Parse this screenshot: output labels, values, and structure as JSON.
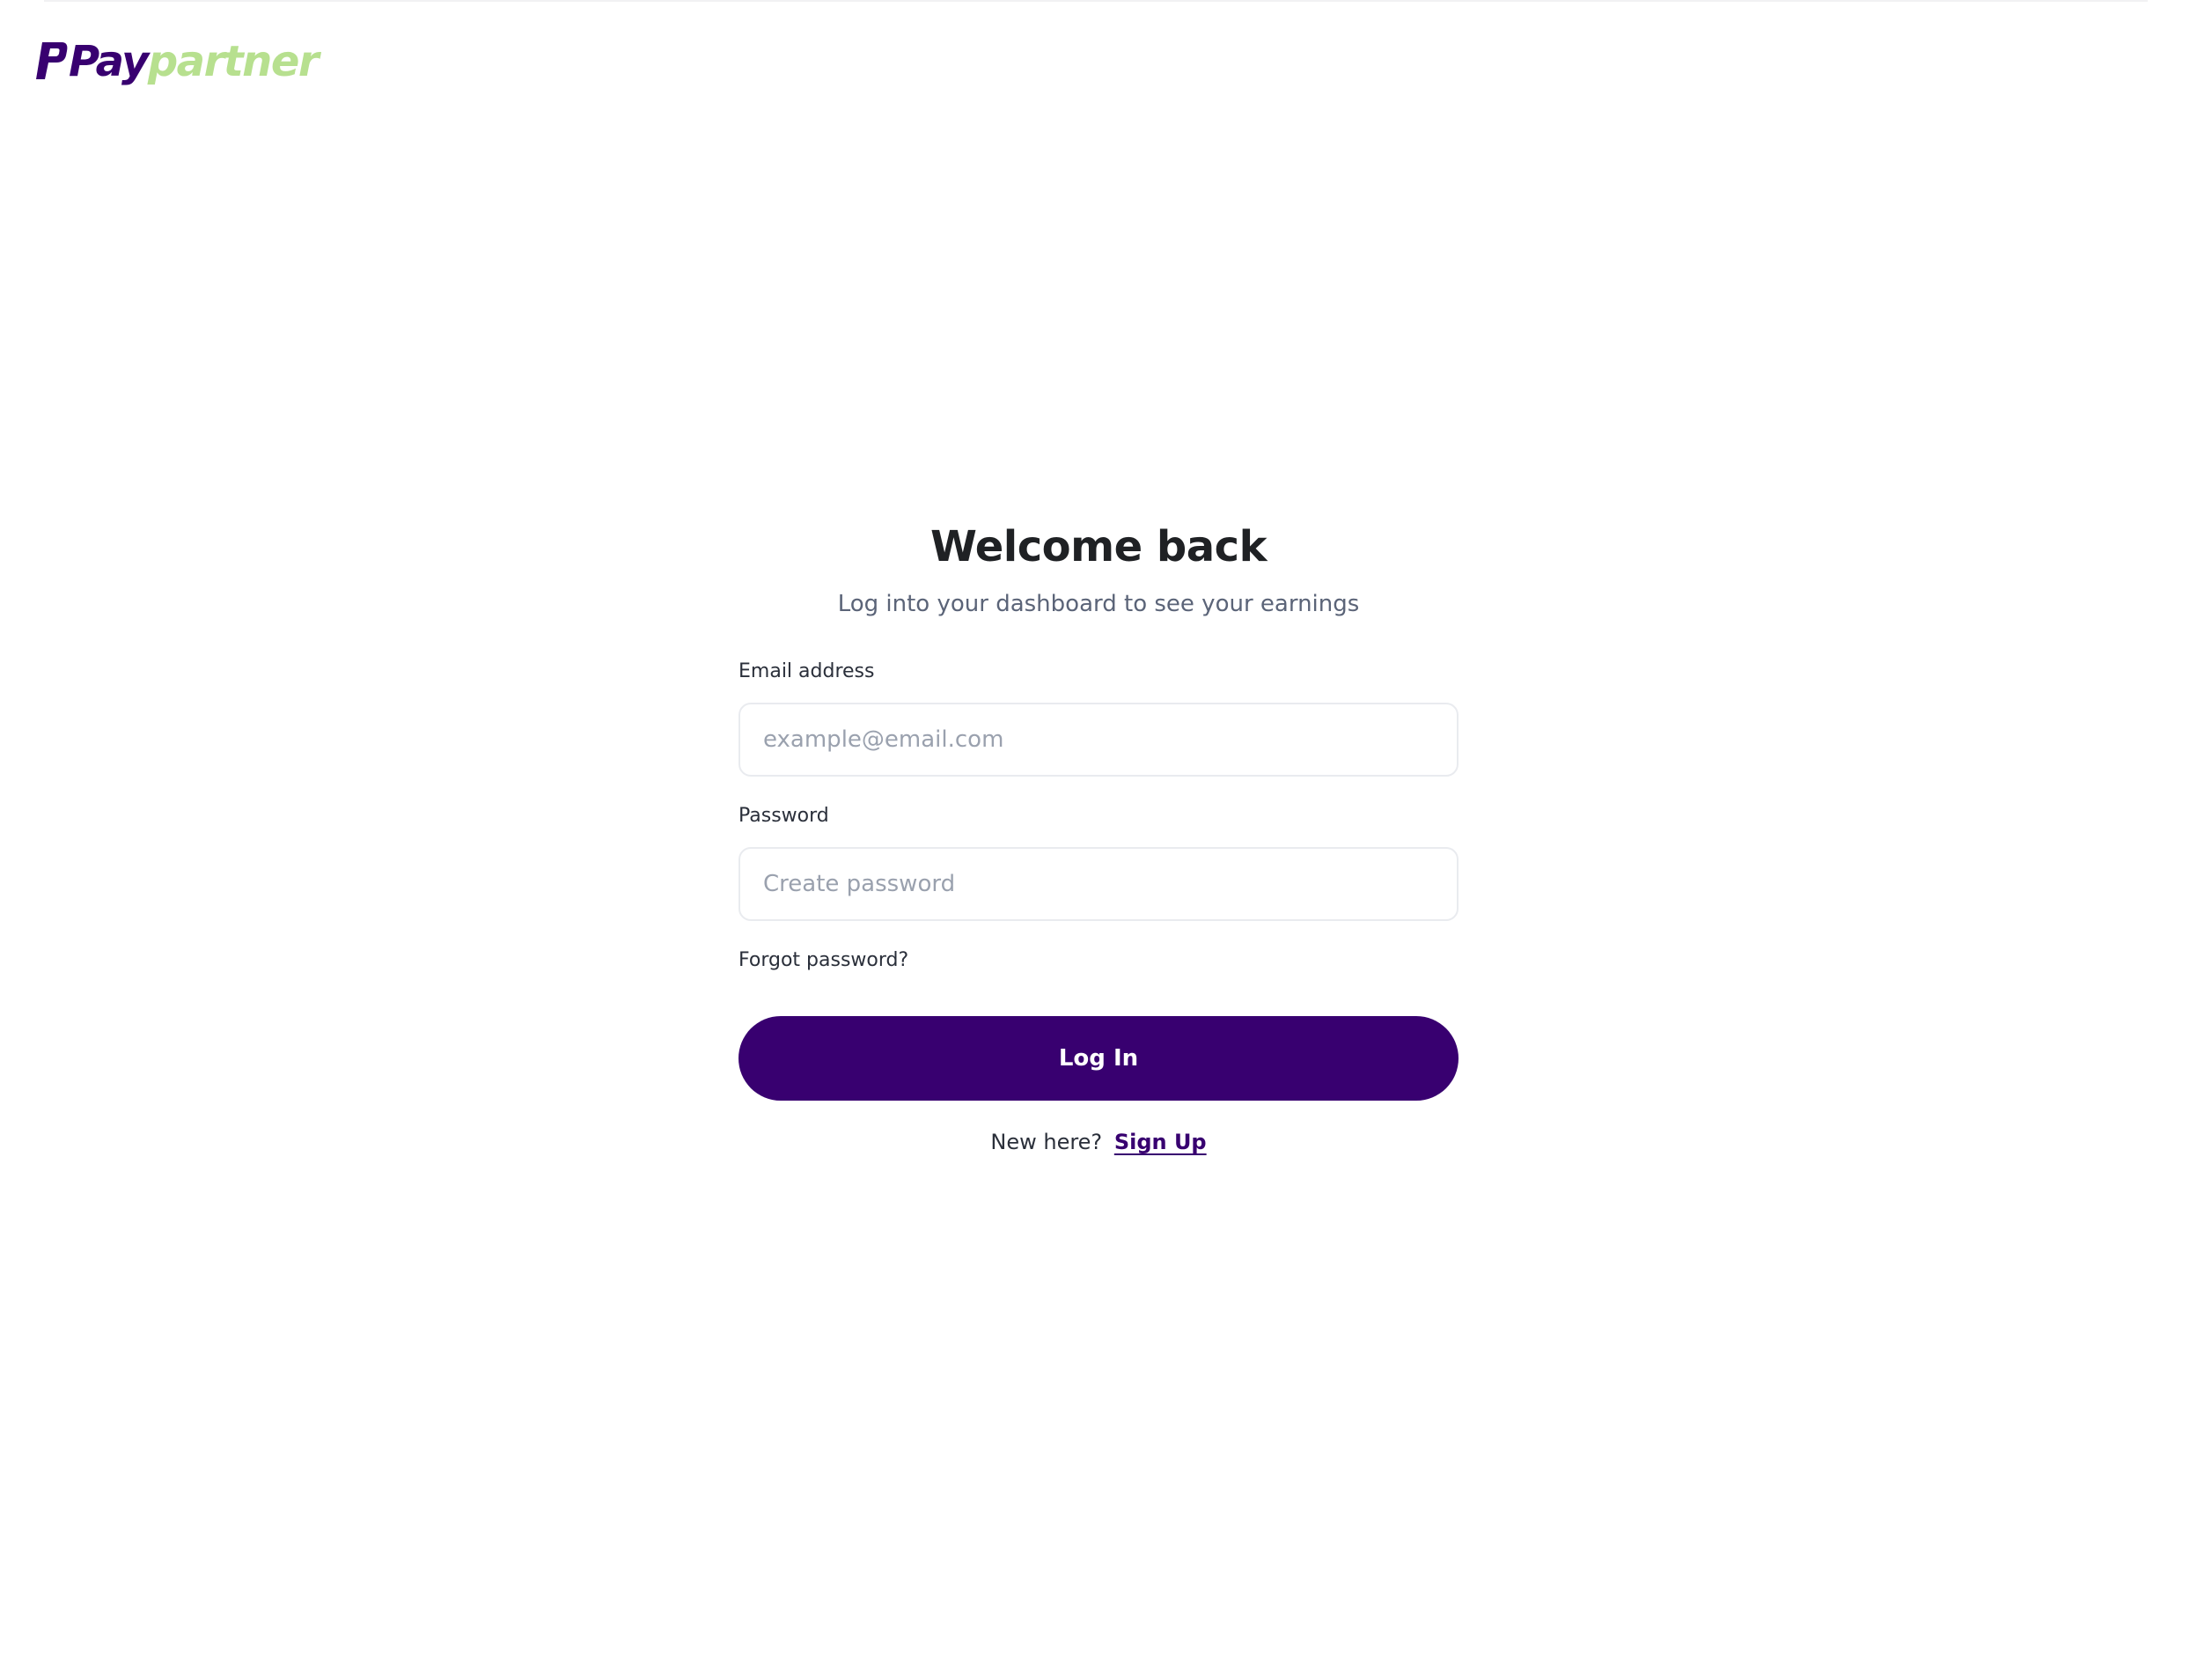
{
  "brand": {
    "name_part1": "Pay",
    "name_part2": "partner",
    "primary_color": "#380070",
    "accent_color": "#b7e08f"
  },
  "login": {
    "title": "Welcome back",
    "subtitle": "Log into your dashboard to see your earnings",
    "email_label": "Email address",
    "email_placeholder": "example@email.com",
    "email_value": "",
    "password_label": "Password",
    "password_placeholder": "Create password",
    "password_value": "",
    "forgot_label": "Forgot password?",
    "submit_label": "Log In",
    "signup_prompt": "New here?",
    "signup_link": "Sign Up"
  }
}
